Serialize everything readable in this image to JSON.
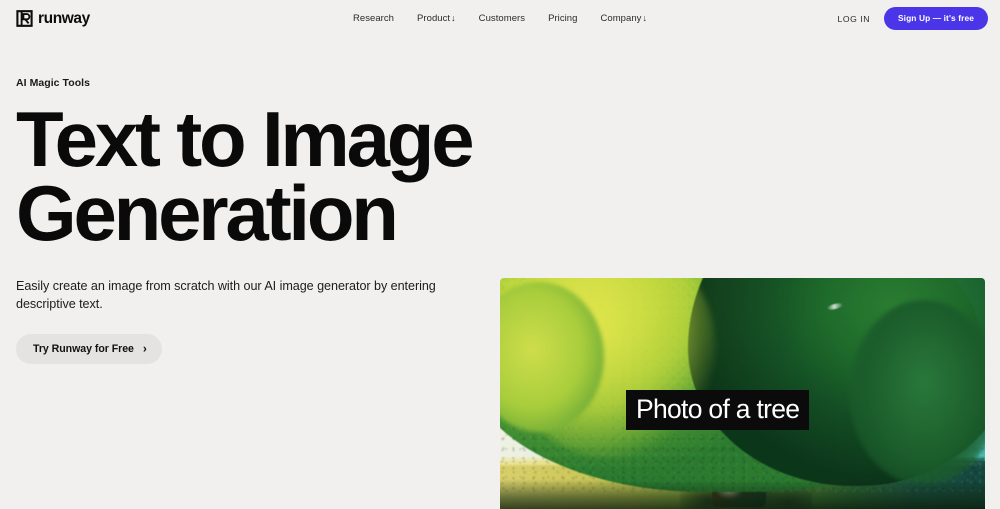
{
  "header": {
    "logo": {
      "mark": "runway-logo-mark",
      "text": "runway"
    },
    "nav": [
      {
        "label": "Research",
        "arrow": ""
      },
      {
        "label": "Product",
        "arrow": "↓"
      },
      {
        "label": "Customers",
        "arrow": ""
      },
      {
        "label": "Pricing",
        "arrow": ""
      },
      {
        "label": "Company",
        "arrow": "↓"
      }
    ],
    "login_label": "LOG IN",
    "signup_label": "Sign Up — it's free",
    "signup_color": "#4a35e8"
  },
  "hero": {
    "eyebrow": "AI Magic Tools",
    "headline": "Text to Image Generation",
    "subtext": "Easily create an image from scratch with our AI image generator by entering descriptive text.",
    "cta_label": "Try Runway for Free",
    "cta_chevron": "›"
  },
  "hero_image": {
    "caption": "Photo of a tree",
    "alt": "generated photo of a large tree in a field",
    "sky_color_left": "#f3f4e2",
    "sky_color_right": "#49bdb5",
    "foliage_color_light": "#d8e14a",
    "foliage_color_dark": "#0f3d22",
    "ground_color_left": "#d8cf6a",
    "ground_color_right": "#14463e"
  },
  "page": {
    "background": "#f1f0ee"
  }
}
